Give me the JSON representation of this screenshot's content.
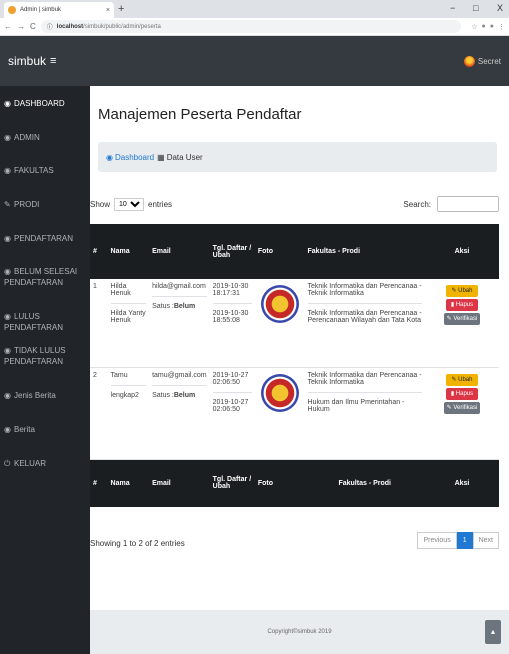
{
  "browser": {
    "tab_title": "Admin | simbuk",
    "tab_close": "×",
    "new_tab": "+",
    "url_host": "localhost",
    "url_path": "/simbuk/public/admin/peserta",
    "win_min": "−",
    "win_max": "□",
    "win_close": "X"
  },
  "app": {
    "brand": "simbuk",
    "menu_icon": "≡",
    "user_name": "Secret"
  },
  "sidebar": {
    "items": [
      {
        "label": "DASHBOARD",
        "icon": "dashboard-icon"
      },
      {
        "label": "ADMIN",
        "icon": "user-icon"
      },
      {
        "label": "FAKULTAS",
        "icon": "user-icon"
      },
      {
        "label": "PRODI",
        "icon": "edit-icon"
      },
      {
        "label": "PENDAFTARAN",
        "icon": "user-icon"
      },
      {
        "label": "BELUM SELESAI PENDAFTARAN",
        "icon": "user-icon"
      },
      {
        "label": "LULUS PENDAFTARAN",
        "icon": "user-icon"
      },
      {
        "label": "TIDAK LULUS PENDAFTARAN",
        "icon": "user-icon"
      },
      {
        "label": "Jenis Berita",
        "icon": "user-icon"
      },
      {
        "label": "Berita",
        "icon": "user-icon"
      },
      {
        "label": "KELUAR",
        "icon": "power-icon"
      }
    ]
  },
  "main": {
    "title": "Manajemen Peserta Pendaftar",
    "breadcrumb_dashboard": "Dashboard",
    "breadcrumb_current": "Data User",
    "show_label": "Show",
    "show_value": "10",
    "entries_label": "entries",
    "search_label": "Search:",
    "columns": [
      "#",
      "Nama",
      "Email",
      "Tgl. Daftar / Ubah",
      "Foto",
      "Fakultas - Prodi",
      "Aksi"
    ],
    "rows": [
      {
        "no": "1",
        "nama1": "Hilda Henuk",
        "nama2": "Hilda Yanty Henuk",
        "email": "hilda@gmail.com",
        "status_label": "Satus :",
        "status_value": "Belum",
        "tgl1": "2019-10-30 18:17:31",
        "tgl2": "2019-10-30 18:55:08",
        "fak1": "Teknik Informatika dan Perencanaa - Teknik Informatika",
        "fak2": "Teknik Informatika dan Perencanaa - Perencanaan Wilayah dan Tata Kota"
      },
      {
        "no": "2",
        "nama1": "Tamu",
        "nama2": "lengkap2",
        "email": "tamu@gmail.com",
        "status_label": "Satus :",
        "status_value": "Belum",
        "tgl1": "2019-10-27 02:06:50",
        "tgl2": "2019-10-27 02:06:50",
        "fak1": "Teknik Informatika dan Perencanaa - Teknik Informatika",
        "fak2": "Hukum dan Ilmu Pmerintahan - Hukum"
      }
    ],
    "btn_ubah": "Ubah",
    "btn_hapus": "Hapus",
    "btn_verif": "Verifikasi",
    "showing_text": "Showing 1 to 2 of 2 entries",
    "pager_prev": "Previous",
    "pager_page": "1",
    "pager_next": "Next"
  },
  "footer": {
    "copyright": "Copyright©simbuk 2019",
    "to_top": "▲"
  }
}
